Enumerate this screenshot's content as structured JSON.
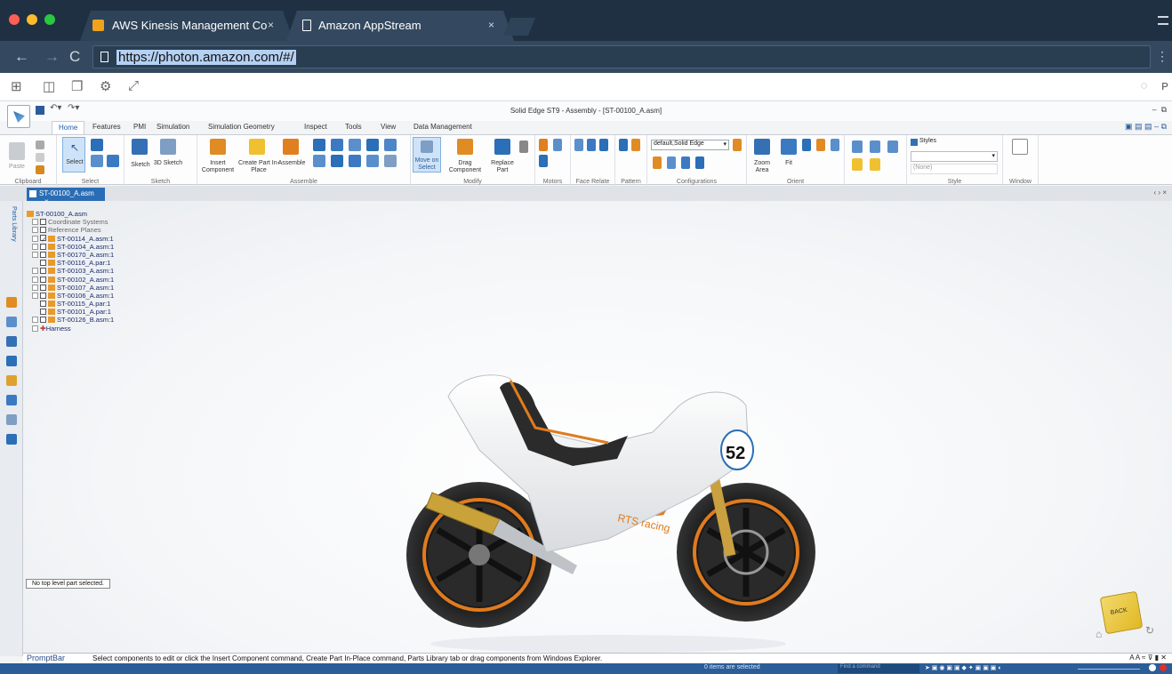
{
  "browser": {
    "tabs": [
      {
        "title": "AWS Kinesis Management Co",
        "close": "×"
      },
      {
        "title": "Amazon AppStream",
        "close": "×"
      }
    ],
    "url": "https://photon.amazon.com/#/"
  },
  "app": {
    "title": "Solid Edge ST9 - Assembly - [ST-00100_A.asm]",
    "ribbon_tabs": [
      "Home",
      "Features",
      "PMI",
      "Simulation",
      "Simulation Geometry",
      "Inspect",
      "Tools",
      "View",
      "Data Management"
    ],
    "groups": [
      "Clipboard",
      "Select",
      "Sketch",
      "Assemble",
      "Modify",
      "Motors",
      "Face Relate",
      "Pattern",
      "Configurations",
      "Orient",
      "Style",
      "Window"
    ],
    "buttons": {
      "paste": "Paste",
      "select": "Select",
      "sketch": "Sketch",
      "sketch3d": "3D Sketch",
      "insert_component": "Insert Component",
      "create_part": "Create Part In-Place",
      "assemble": "Assemble",
      "move_on_select": "Move on Select",
      "drag_component": "Drag Component",
      "replace_part": "Replace Part",
      "zoom_area": "Zoom Area",
      "fit": "Fit"
    },
    "config_value": "default,Solid Edge",
    "styles_label": "Styles",
    "style_none": "(None)",
    "document_tab": "ST-00100_A.asm",
    "parts_library": "Parts Library",
    "tree": [
      "ST-00100_A.asm",
      "Coordinate Systems",
      "Reference Planes",
      "ST-00114_A.asm:1",
      "ST-00104_A.asm:1",
      "ST-00170_A.asm:1",
      "ST-00116_A.par:1",
      "ST-00103_A.asm:1",
      "ST-00102_A.asm:1",
      "ST-00107_A.asm:1",
      "ST-00106_A.asm:1",
      "ST-00115_A.par:1",
      "ST-00101_A.par:1",
      "ST-00126_B.asm:1",
      "Harness"
    ],
    "status_message": "No top level part selected.",
    "viewcube_face": "BACK",
    "prompt_label": "PromptBar",
    "prompt_text": "Select components to edit or click the Insert Component command, Create Part In-Place command, Parts Library tab or drag components from Windows Explorer.",
    "items_selected": "0 items are selected",
    "find_placeholder": "Find a command",
    "bike_number": "52",
    "bike_brand": "RTS racing"
  }
}
